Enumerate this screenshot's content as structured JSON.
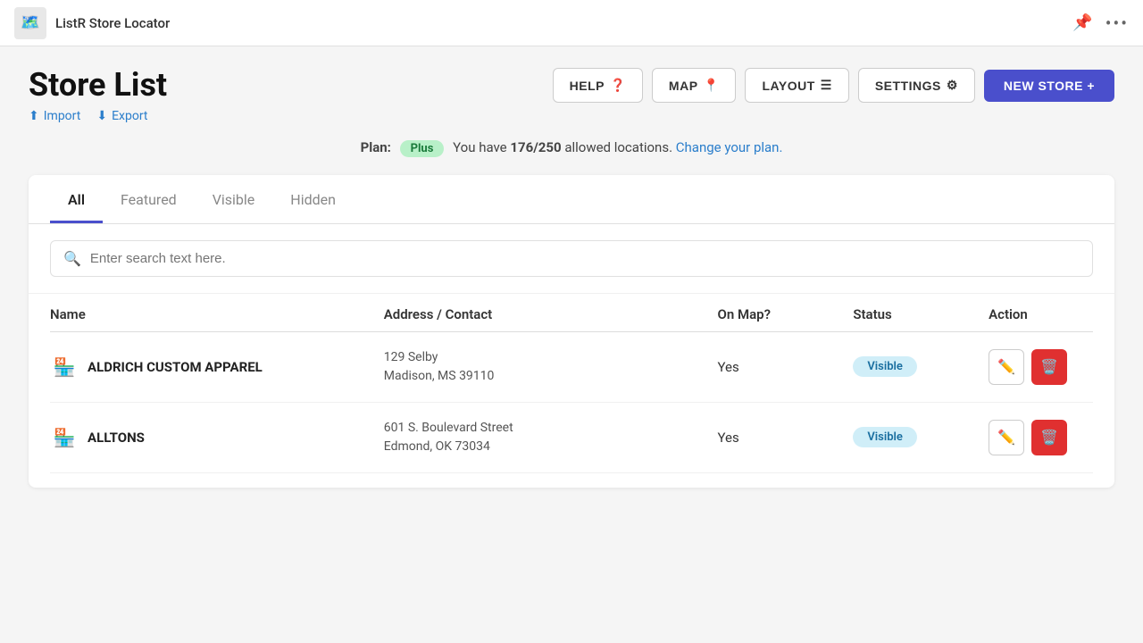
{
  "app": {
    "title": "ListR Store Locator",
    "logo": "🗺️"
  },
  "topbar": {
    "pin_icon": "📌",
    "more_icon": "•••"
  },
  "header": {
    "page_title": "Store List",
    "import_label": "Import",
    "export_label": "Export",
    "help_label": "HELP",
    "map_label": "MAP",
    "layout_label": "LAYOUT",
    "settings_label": "SETTINGS",
    "new_store_label": "NEW STORE +"
  },
  "plan": {
    "label": "Plan:",
    "badge": "Plus",
    "text_pre": "You have",
    "count": "176/250",
    "text_post": "allowed locations.",
    "change_link": "Change your plan."
  },
  "tabs": [
    {
      "label": "All",
      "active": true
    },
    {
      "label": "Featured",
      "active": false
    },
    {
      "label": "Visible",
      "active": false
    },
    {
      "label": "Hidden",
      "active": false
    }
  ],
  "search": {
    "placeholder": "Enter search text here."
  },
  "table": {
    "columns": {
      "name": "Name",
      "address": "Address / Contact",
      "on_map": "On Map?",
      "status": "Status",
      "action": "Action"
    },
    "rows": [
      {
        "name": "ALDRICH CUSTOM APPAREL",
        "address_line1": "129 Selby",
        "address_line2": "Madison, MS 39110",
        "on_map": "Yes",
        "status": "Visible"
      },
      {
        "name": "ALLTONS",
        "address_line1": "601 S. Boulevard Street",
        "address_line2": "Edmond, OK 73034",
        "on_map": "Yes",
        "status": "Visible"
      }
    ]
  }
}
